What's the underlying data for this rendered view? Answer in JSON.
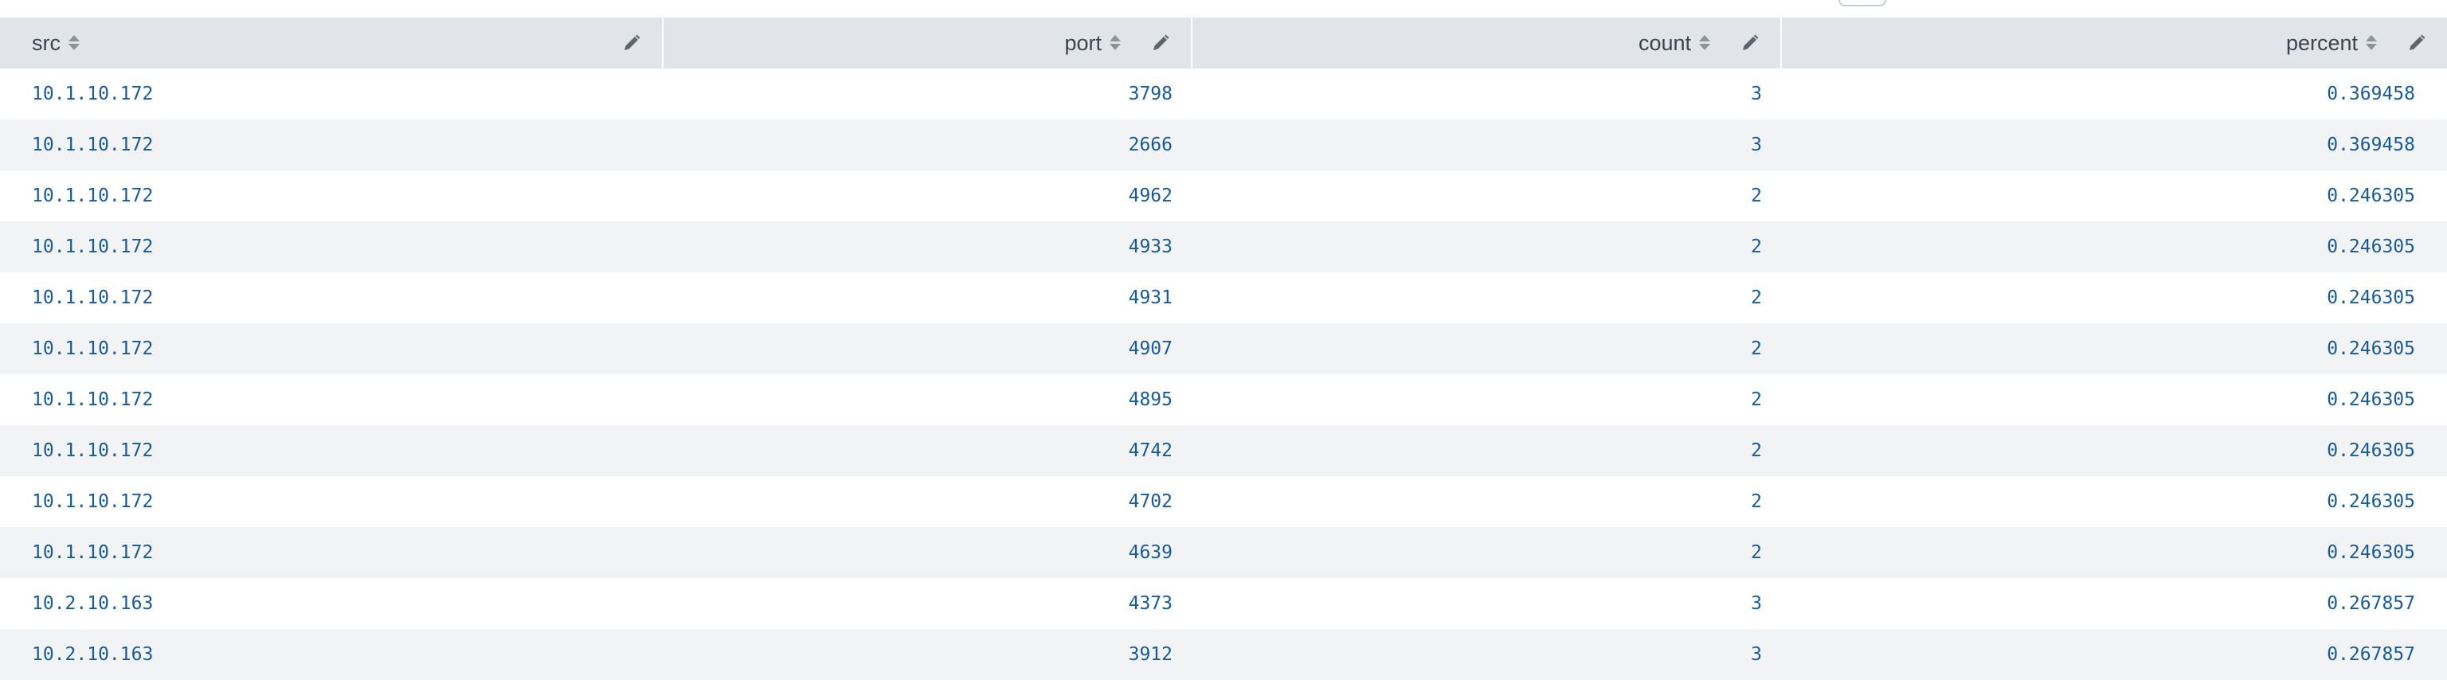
{
  "columns": [
    {
      "key": "src",
      "label": "src",
      "align": "left"
    },
    {
      "key": "port",
      "label": "port",
      "align": "right"
    },
    {
      "key": "count",
      "label": "count",
      "align": "right"
    },
    {
      "key": "percent",
      "label": "percent",
      "align": "right"
    }
  ],
  "rows": [
    {
      "src": "10.1.10.172",
      "port": "3798",
      "count": "3",
      "percent": "0.369458"
    },
    {
      "src": "10.1.10.172",
      "port": "2666",
      "count": "3",
      "percent": "0.369458"
    },
    {
      "src": "10.1.10.172",
      "port": "4962",
      "count": "2",
      "percent": "0.246305"
    },
    {
      "src": "10.1.10.172",
      "port": "4933",
      "count": "2",
      "percent": "0.246305"
    },
    {
      "src": "10.1.10.172",
      "port": "4931",
      "count": "2",
      "percent": "0.246305"
    },
    {
      "src": "10.1.10.172",
      "port": "4907",
      "count": "2",
      "percent": "0.246305"
    },
    {
      "src": "10.1.10.172",
      "port": "4895",
      "count": "2",
      "percent": "0.246305"
    },
    {
      "src": "10.1.10.172",
      "port": "4742",
      "count": "2",
      "percent": "0.246305"
    },
    {
      "src": "10.1.10.172",
      "port": "4702",
      "count": "2",
      "percent": "0.246305"
    },
    {
      "src": "10.1.10.172",
      "port": "4639",
      "count": "2",
      "percent": "0.246305"
    },
    {
      "src": "10.2.10.163",
      "port": "4373",
      "count": "3",
      "percent": "0.267857"
    },
    {
      "src": "10.2.10.163",
      "port": "3912",
      "count": "3",
      "percent": "0.267857"
    }
  ],
  "icons": {
    "sort": "sort-icon",
    "edit": "pencil-icon"
  },
  "colors": {
    "header_bg": "#e1e4e9",
    "row_alt_bg": "#f2f3f5",
    "cell_text": "#1a5a96",
    "header_text": "#3c444d"
  }
}
